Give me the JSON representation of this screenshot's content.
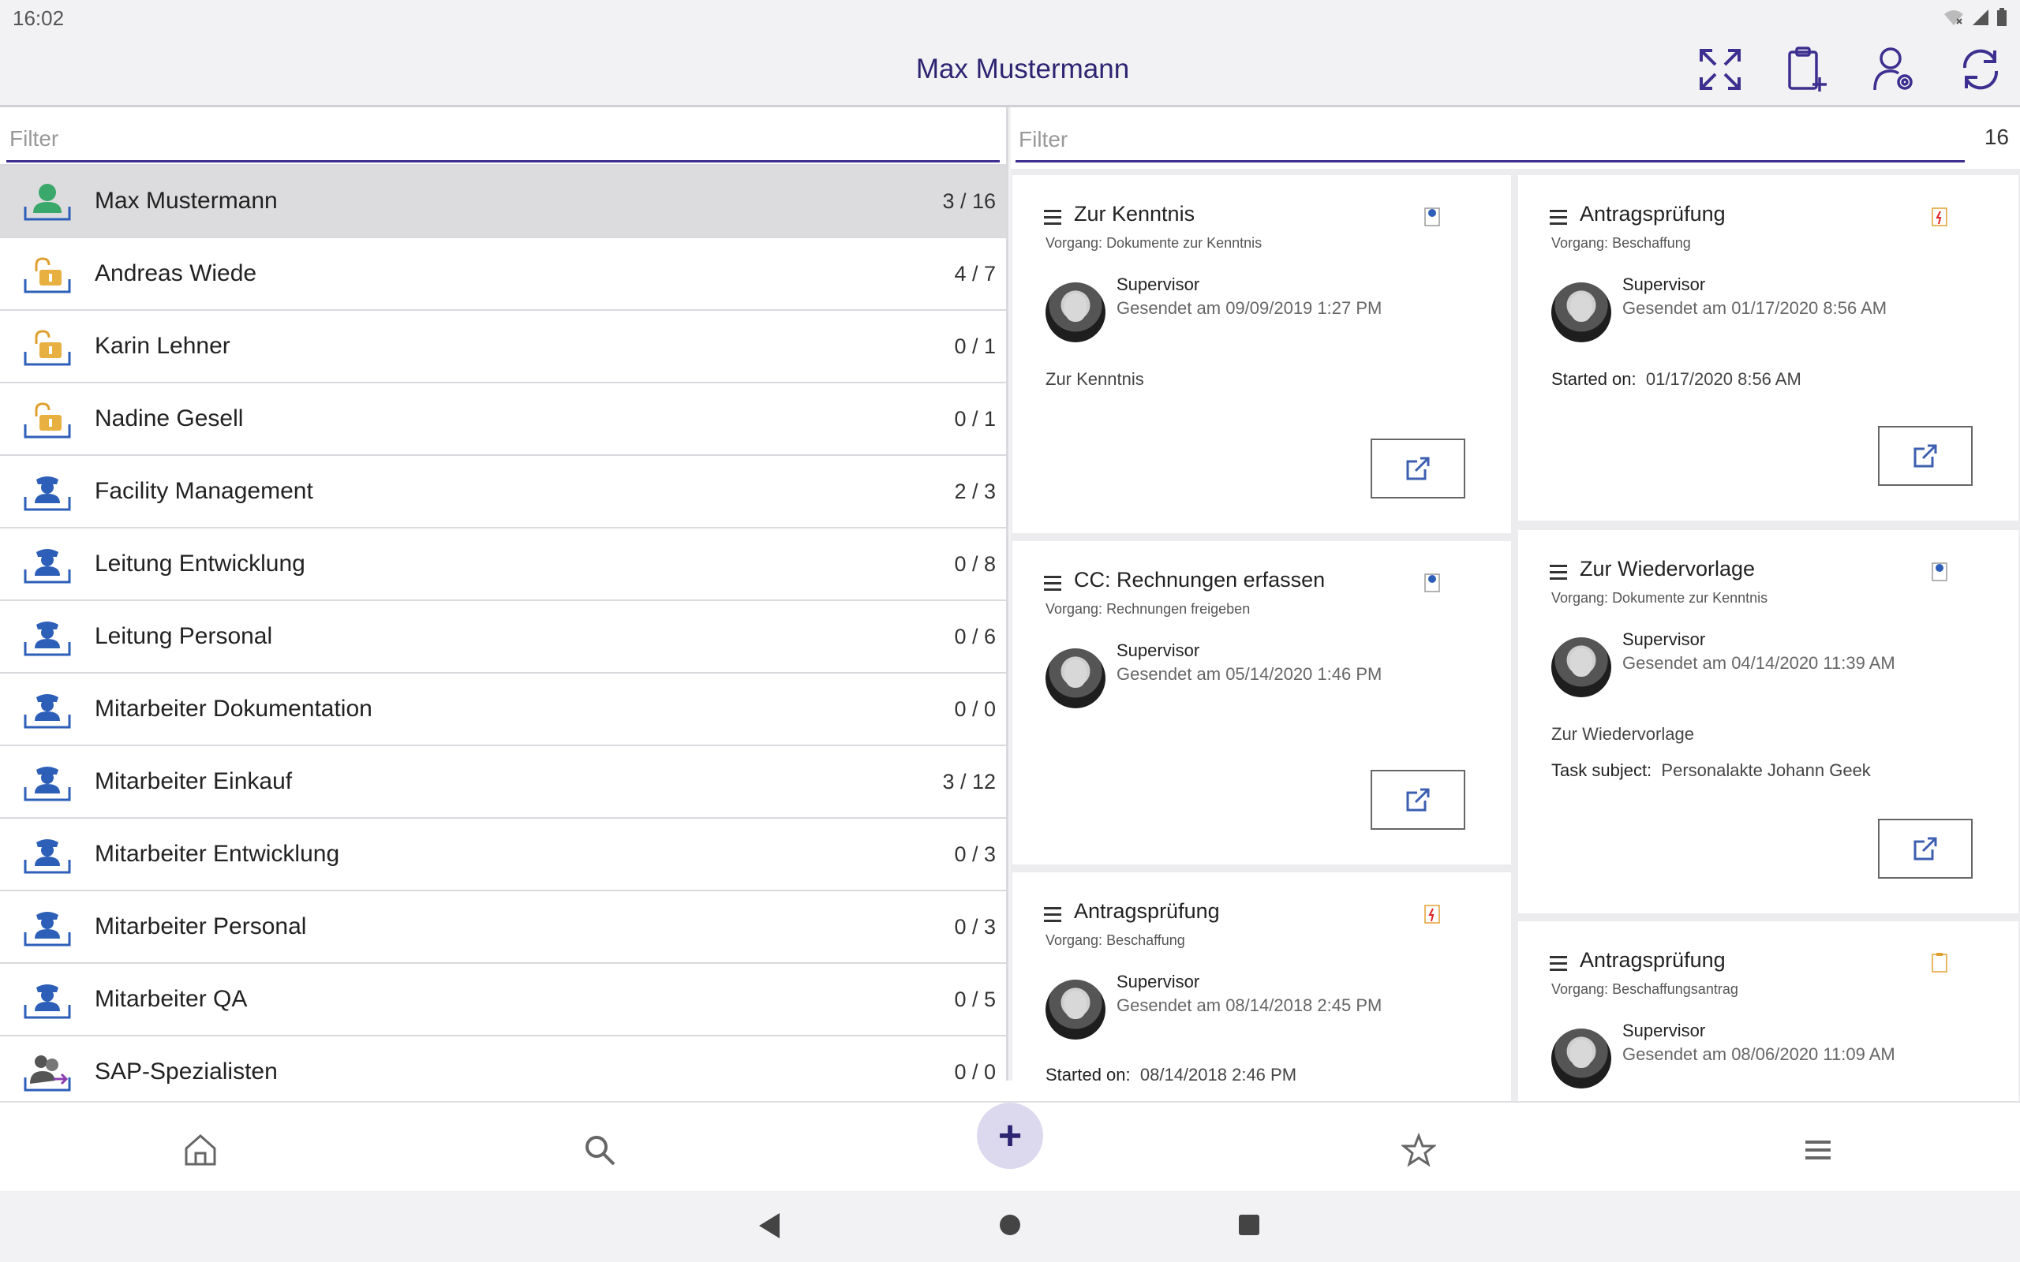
{
  "status_bar": {
    "time": "16:02"
  },
  "app_bar": {
    "title": "Max Mustermann",
    "actions": [
      {
        "icon": "expand-icon"
      },
      {
        "icon": "clipboard-add-icon"
      },
      {
        "icon": "user-settings-icon"
      },
      {
        "icon": "refresh-icon"
      }
    ]
  },
  "colors": {
    "accent": "#2d2472",
    "filter_underline": "#3c2f8f",
    "selected_row": "#dcdcde"
  },
  "left": {
    "filter_placeholder": "Filter",
    "items": [
      {
        "name": "Max Mustermann",
        "count": "3 / 16",
        "icon": "user-green-icon",
        "selected": true
      },
      {
        "name": "Andreas Wiede",
        "count": "4 / 7",
        "icon": "substitute-lock-icon"
      },
      {
        "name": "Karin Lehner",
        "count": "0 / 1",
        "icon": "substitute-lock-icon"
      },
      {
        "name": "Nadine Gesell",
        "count": "0 / 1",
        "icon": "substitute-lock-icon"
      },
      {
        "name": "Facility Management",
        "count": "2 / 3",
        "icon": "role-icon"
      },
      {
        "name": "Leitung Entwicklung",
        "count": "0 / 8",
        "icon": "role-icon"
      },
      {
        "name": "Leitung Personal",
        "count": "0 / 6",
        "icon": "role-icon"
      },
      {
        "name": "Mitarbeiter Dokumentation",
        "count": "0 / 0",
        "icon": "role-icon"
      },
      {
        "name": "Mitarbeiter Einkauf",
        "count": "3 / 12",
        "icon": "role-icon"
      },
      {
        "name": "Mitarbeiter Entwicklung",
        "count": "0 / 3",
        "icon": "role-icon"
      },
      {
        "name": "Mitarbeiter Personal",
        "count": "0 / 3",
        "icon": "role-icon"
      },
      {
        "name": "Mitarbeiter QA",
        "count": "0 / 5",
        "icon": "role-icon"
      },
      {
        "name": "SAP-Spezialisten",
        "count": "0 / 0",
        "icon": "group-icon"
      }
    ]
  },
  "right": {
    "filter_placeholder": "Filter",
    "total": "16",
    "cards": [
      {
        "title": "Zur Kenntnis",
        "subtitle": "Vorgang: Dokumente zur Kenntnis",
        "sender": "Supervisor",
        "sent": "Gesendet am 09/09/2019 1:27 PM",
        "text": "Zur Kenntnis",
        "badge": "info-clipboard-icon"
      },
      {
        "title": "Antragsprüfung",
        "subtitle": "Vorgang: Beschaffung",
        "sender": "Supervisor",
        "sent": "Gesendet am 01/17/2020 8:56 AM",
        "started_label": "Started on:",
        "started_value": "01/17/2020 8:56 AM",
        "badge": "urgent-clipboard-icon"
      },
      {
        "title": "CC: Rechnungen erfassen",
        "subtitle": "Vorgang: Rechnungen freigeben",
        "sender": "Supervisor",
        "sent": "Gesendet am 05/14/2020 1:46 PM",
        "badge": "info-clipboard-icon"
      },
      {
        "title": "Zur Wiedervorlage",
        "subtitle": "Vorgang: Dokumente zur Kenntnis",
        "sender": "Supervisor",
        "sent": "Gesendet am 04/14/2020 11:39 AM",
        "text": "Zur Wiedervorlage",
        "task_label": "Task subject:",
        "task_value": "Personalakte Johann Geek",
        "badge": "info-clipboard-icon"
      },
      {
        "title": "Antragsprüfung",
        "subtitle": "Vorgang: Beschaffung",
        "sender": "Supervisor",
        "sent": "Gesendet am 08/14/2018 2:45 PM",
        "started_label": "Started on:",
        "started_value": "08/14/2018 2:46 PM",
        "badge": "urgent-clipboard-icon"
      },
      {
        "title": "Antragsprüfung",
        "subtitle": "Vorgang: Beschaffungsantrag",
        "sender": "Supervisor",
        "sent": "Gesendet am 08/06/2020 11:09 AM",
        "badge": "clipboard-icon"
      }
    ]
  },
  "bottom_nav": [
    {
      "icon": "home-icon"
    },
    {
      "icon": "search-icon"
    },
    {
      "icon": "plus-icon",
      "label": "+"
    },
    {
      "icon": "star-icon"
    },
    {
      "icon": "menu-icon"
    }
  ]
}
